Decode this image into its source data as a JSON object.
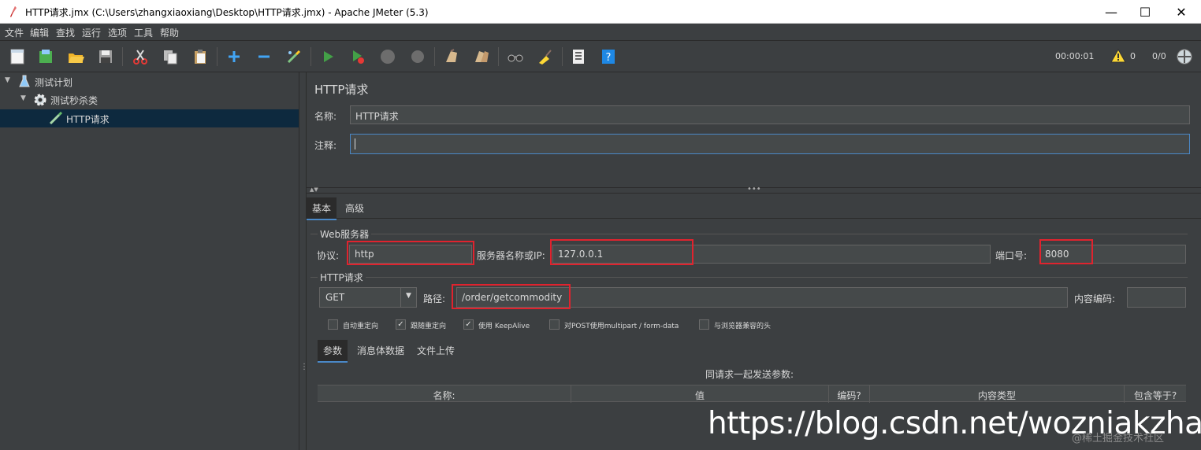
{
  "window": {
    "title": "HTTP请求.jmx (C:\\Users\\zhangxiaoxiang\\Desktop\\HTTP请求.jmx) - Apache JMeter (5.3)",
    "minimize": "—",
    "maximize": "☐",
    "close": "✕"
  },
  "menu": [
    "文件",
    "编辑",
    "查找",
    "运行",
    "选项",
    "工具",
    "帮助"
  ],
  "toolbar": {
    "icons": [
      "new-icon",
      "templates-icon",
      "open-icon",
      "save-icon",
      "cut-icon",
      "copy-icon",
      "paste-icon",
      "add-icon",
      "remove-icon",
      "toggle-icon",
      "start-icon",
      "start-no-pause-icon",
      "stop-icon",
      "shutdown-icon",
      "clear-icon",
      "clear-all-icon",
      "search-icon",
      "reset-search-icon",
      "function-helper-icon",
      "help-icon"
    ],
    "timer": "00:00:01",
    "warnings": "0",
    "threads": "0/0"
  },
  "tree": {
    "plan": "测试计划",
    "thread_group": "测试秒杀类",
    "sampler": "HTTP请求"
  },
  "panel": {
    "title": "HTTP请求",
    "name_label": "名称:",
    "name_value": "HTTP请求",
    "comment_label": "注释:",
    "comment_value": "",
    "tabs": [
      "基本",
      "高级"
    ],
    "web_server_legend": "Web服务器",
    "protocol_label": "协议:",
    "protocol_value": "http",
    "server_label": "服务器名称或IP:",
    "server_value": "127.0.0.1",
    "port_label": "端口号:",
    "port_value": "8080",
    "http_request_legend": "HTTP请求",
    "method_value": "GET",
    "path_label": "路径:",
    "path_value": "/order/getcommodity",
    "encoding_label": "内容编码:",
    "encoding_value": "",
    "checkboxes": [
      {
        "label": "自动重定向",
        "checked": false
      },
      {
        "label": "跟随重定向",
        "checked": true
      },
      {
        "label": "使用 KeepAlive",
        "checked": true
      },
      {
        "label": "对POST使用multipart / form-data",
        "checked": false
      },
      {
        "label": "与浏览器兼容的头",
        "checked": false
      }
    ],
    "sub_tabs": [
      "参数",
      "消息体数据",
      "文件上传"
    ],
    "params_caption": "同请求一起发送参数:",
    "columns": [
      "名称:",
      "值",
      "编码?",
      "内容类型",
      "包含等于?"
    ]
  },
  "watermark": "https://blog.csdn.net/wozniakzhang",
  "watermark2": "@稀土掘金技术社区"
}
